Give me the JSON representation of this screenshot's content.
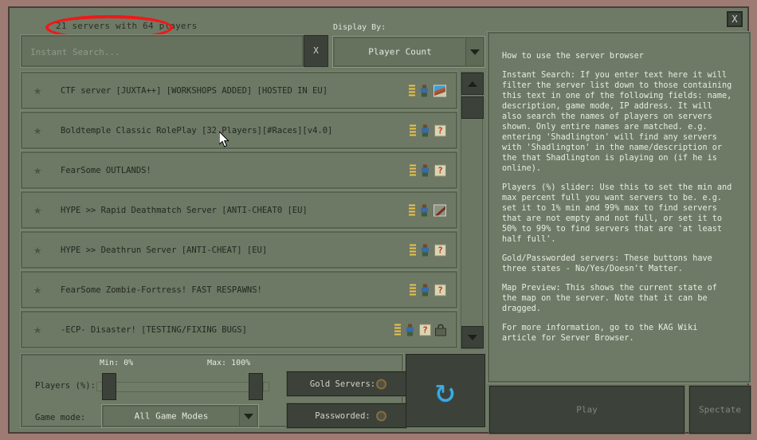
{
  "window": {
    "close_label": "X"
  },
  "header": {
    "server_count": "21 servers with 64 players",
    "display_by_label": "Display By:",
    "display_by_value": "Player Count"
  },
  "search": {
    "placeholder": "Instant Search...",
    "value": "",
    "clear_label": "X"
  },
  "servers": [
    {
      "name": "CTF server [JUXTA++] [WORKSHOPS ADDED] [HOSTED IN EU]",
      "preview": "map",
      "locked": false
    },
    {
      "name": "Boldtemple Classic RolePlay [32 Players][#Races][v4.0]",
      "preview": "question",
      "locked": false
    },
    {
      "name": "FearSome OUTLANDS!",
      "preview": "question",
      "locked": false
    },
    {
      "name": "HYPE >> Rapid Deathmatch Server [ANTI-CHEAT0 [EU]",
      "preview": "sword",
      "locked": false
    },
    {
      "name": "HYPE >> Deathrun Server [ANTI-CHEAT] [EU]",
      "preview": "question",
      "locked": false
    },
    {
      "name": "FearSome Zombie-Fortress! FAST RESPAWNS!",
      "preview": "question",
      "locked": false
    },
    {
      "name": "-ECP- Disaster! [TESTING/FIXING BUGS]",
      "preview": "question",
      "locked": true
    }
  ],
  "help": {
    "title": "How to use the server browser",
    "paragraphs": [
      "Instant Search: If you enter text here it will filter the server list down to those containing this text in one of the following fields: name, description, game mode, IP address. It will also search the names of players on servers shown.  Only entire names are matched. e.g. entering 'Shadlington' will find any servers with 'Shadlington' in the name/description or the that Shadlington is playing on (if he is online).",
      "Players (%) slider: Use this to set the min and max percent full you want servers to be. e.g. set it to 1% min and 99% max to find servers that are not empty and not full, or set it to 50% to 99% to find servers that are 'at least half full'.",
      "Gold/Passworded servers: These buttons have three states - No/Yes/Doesn't Matter.",
      "Map Preview: This shows the current state of the map on the server. Note that it can be dragged.",
      "For more information, go to the KAG Wiki article for Server Browser."
    ]
  },
  "filters": {
    "players_label": "Players (%):",
    "min_label": "Min: 0%",
    "max_label": "Max: 100%",
    "min_value": 0,
    "max_value": 100,
    "gamemode_label": "Game mode:",
    "gamemode_value": "All Game Modes",
    "gold_label": "Gold Servers:",
    "passworded_label": "Passworded:"
  },
  "actions": {
    "refresh_icon": "refresh-icon",
    "play_label": "Play",
    "spectate_label": "Spectate"
  },
  "colors": {
    "frame": "#9d7b72",
    "panel": "#6e7a66",
    "dark_button": "#3c423a",
    "accent_blue": "#3fa9e0",
    "annotation_red": "#f01818",
    "bars_yellow": "#e8c24e"
  }
}
